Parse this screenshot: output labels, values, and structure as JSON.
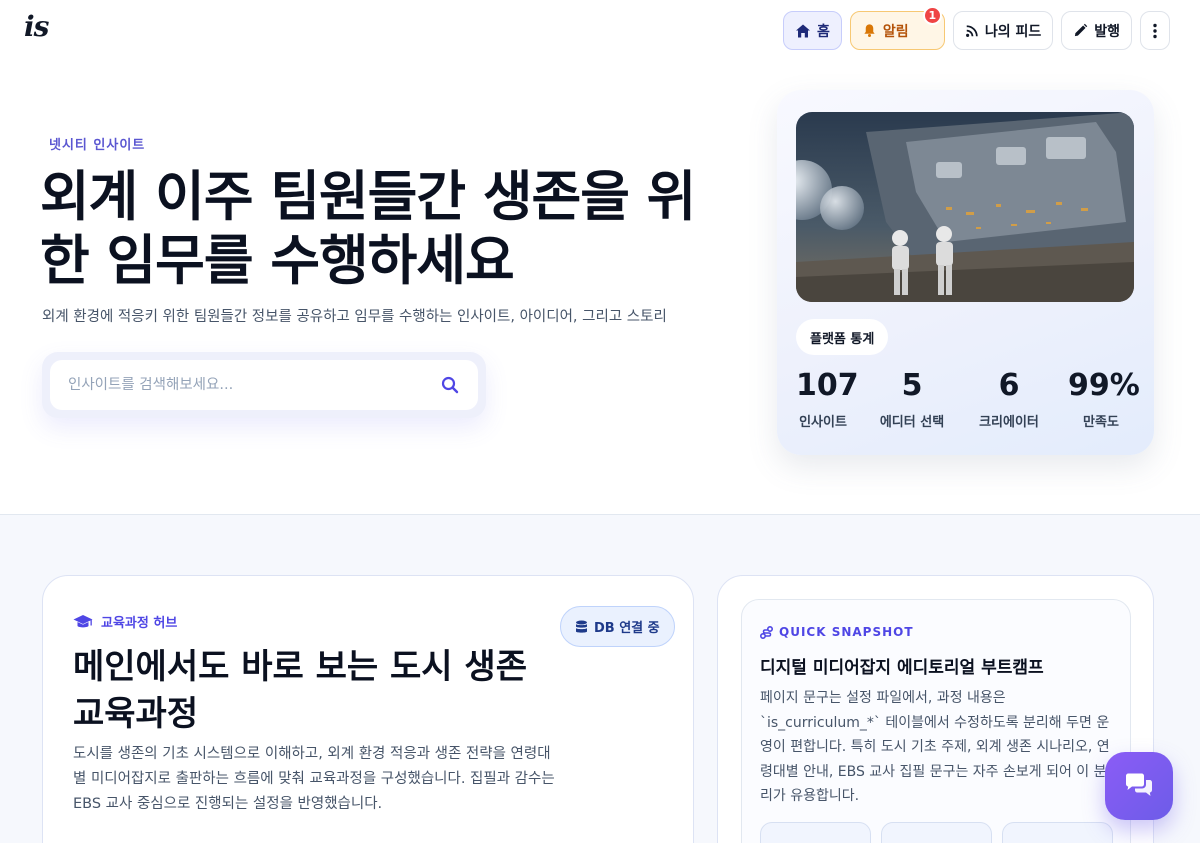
{
  "header": {
    "logo": "is",
    "nav": {
      "home": "홈",
      "alerts": "알림",
      "alerts_badge": "1",
      "feed": "나의 피드",
      "publish": "발행"
    }
  },
  "hero": {
    "eyebrow": "넷시티 인사이트",
    "title": "외계 이주 팀원들간 생존을 위한 임무를 수행하세요",
    "subtitle": "외계 환경에 적응키 위한 팀원들간 정보를 공유하고 임무를 수행하는 인사이트, 아이디어, 그리고 스토리",
    "search_placeholder": "인사이트를 검색해보세요..."
  },
  "stats": {
    "pill": "플랫폼 통계",
    "items": [
      {
        "value": "107",
        "label": "인사이트"
      },
      {
        "value": "5",
        "label": "에디터 선택"
      },
      {
        "value": "6",
        "label": "크리에이터"
      },
      {
        "value": "99%",
        "label": "만족도"
      }
    ]
  },
  "curriculum": {
    "kicker": "교육과정 허브",
    "db_status": "DB 연결 중",
    "title": "메인에서도 바로 보는 도시 생존 교육과정",
    "desc": "도시를 생존의 기초 시스템으로 이해하고, 외계 환경 적응과 생존 전략을 연령대별 미디어잡지로 출판하는 흐름에 맞춰 교육과정을 구성했습니다. 집필과 감수는 EBS 교사 중심으로 진행되는 설정을 반영했습니다."
  },
  "snapshot": {
    "kicker": "QUICK SNAPSHOT",
    "title": "디지털 미디어잡지 에디토리얼 부트캠프",
    "desc": "페이지 문구는 설정 파일에서, 과정 내용은 `is_curriculum_*` 테이블에서 수정하도록 분리해 두면 운영이 편합니다. 특히 도시 기초 주제, 외계 생존 시나리오, 연령대별 안내, EBS 교사 집필 문구는 자주 손보게 되어 이 분리가 유용합니다."
  },
  "colors": {
    "accent": "#4f46e5",
    "alert_badge": "#ef4444",
    "chat_fab": "#7c5ce8"
  }
}
